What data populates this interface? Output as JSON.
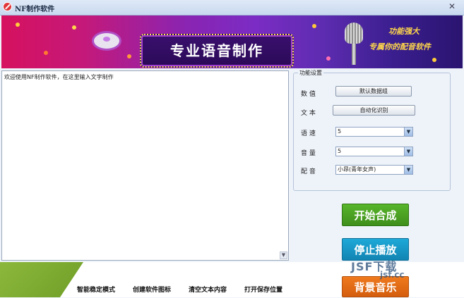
{
  "window": {
    "title": "NF制作软件",
    "close_label": "✕"
  },
  "banner": {
    "headline": "专业语音制作",
    "slogan_line1": "功能强大",
    "slogan_line2": "专属你的配音软件"
  },
  "editor": {
    "text": "欢迎使用NF制作软件，在这里输入文字制作"
  },
  "settings": {
    "legend": "功能设置",
    "data_label": "数 值",
    "data_button": "默认数据组",
    "text_label": "文 本",
    "text_button": "自动化识别",
    "speed_label": "语 速",
    "speed_value": "5",
    "volume_label": "音 量",
    "volume_value": "5",
    "voice_label": "配 音",
    "voice_value": "小昂(青年女声)"
  },
  "actions": {
    "start_label": "开始合成",
    "stop_label": "停止播放",
    "bgm_label": "背景音乐"
  },
  "footer": {
    "link1": "智能稳定模式",
    "link2": "创建软件图标",
    "link3": "清空文本内容",
    "link4": "打开保存位置"
  },
  "watermark": {
    "line1": "JSF下载",
    "line2": "jsf.cc"
  },
  "colors": {
    "start": "#58b52a",
    "stop": "#1ea9d8",
    "bgm": "#f07a1d"
  }
}
